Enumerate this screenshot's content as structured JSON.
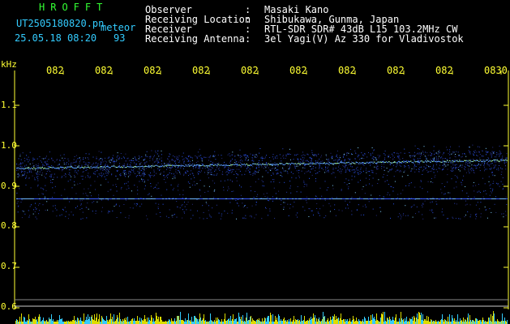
{
  "header": {
    "brand": "HROFFT",
    "filename": "UT2505180820.pn",
    "mode": "meteor",
    "datetime": "25.05.18 08:20",
    "count": "93",
    "fields": [
      {
        "label": "Observer",
        "value": "Masaki Kano"
      },
      {
        "label": "Receiving Location",
        "value": "Shibukawa, Gunma, Japan"
      },
      {
        "label": "Receiver",
        "value": "RTL-SDR SDR# 43dB L15 103.2MHz CW"
      },
      {
        "label": "Receiving Antenna",
        "value": "3el Yagi(V) Az 330 for Vladivostok"
      }
    ],
    "separator": ":"
  },
  "axes": {
    "y_unit": "kHz",
    "y_ticks": [
      "1.1",
      "1.0",
      "0.9",
      "0.8",
      "0.7",
      "0.6"
    ],
    "x_ticks": [
      "082",
      "082",
      "082",
      "082",
      "082",
      "082",
      "082",
      "082",
      "082",
      "0830"
    ]
  },
  "colors": {
    "text_green": "#33ff33",
    "text_yellow": "#ffff33",
    "text_cyan": "#33ccff",
    "background": "#000000",
    "signal_blue": "#2a3fff"
  },
  "spectrogram": {
    "y_range_khz": [
      0.6,
      1.1
    ],
    "band_center_khz_left": 0.945,
    "band_center_khz_right": 0.965,
    "band_lower_edge_khz": 0.82,
    "carrier_line_khz": 0.87
  }
}
